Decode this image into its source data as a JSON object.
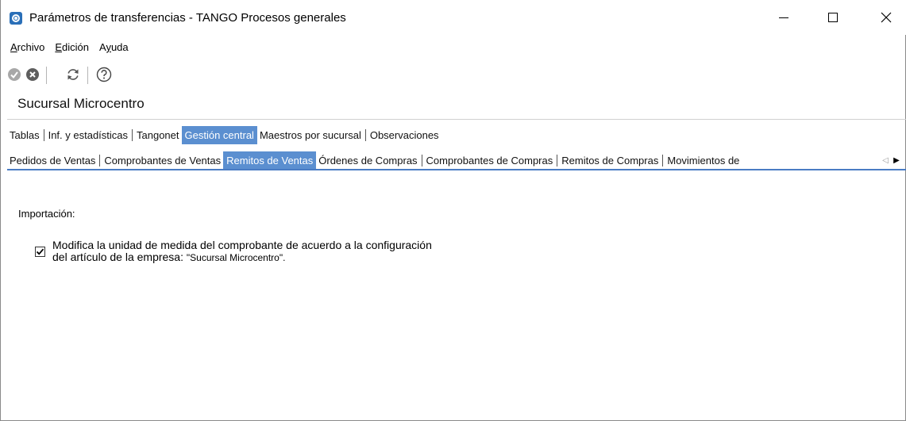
{
  "window": {
    "title": "Parámetros de transferencias - TANGO Procesos generales",
    "icon": "tango-app-icon"
  },
  "menu": {
    "items": [
      {
        "label_u": "A",
        "label_rest": "rchivo"
      },
      {
        "label_u": "E",
        "label_rest": "dición"
      },
      {
        "label_pre": "A",
        "label_u": "y",
        "label_rest": "uda"
      }
    ]
  },
  "toolbar": {
    "icons": [
      "check-icon",
      "cancel-icon",
      "refresh-icon",
      "help-icon"
    ]
  },
  "branch": {
    "title": "Sucursal Microcentro"
  },
  "tabs_main": [
    {
      "label": "Tablas",
      "active": false
    },
    {
      "label": "Inf. y estadísticas",
      "active": false
    },
    {
      "label": "Tangonet",
      "active": false
    },
    {
      "label": "Gestión central",
      "active": true
    },
    {
      "label": "Maestros por sucursal",
      "active": false
    },
    {
      "label": "Observaciones",
      "active": false
    }
  ],
  "tabs_sub": [
    {
      "label": "Pedidos de Ventas",
      "active": false
    },
    {
      "label": "Comprobantes de Ventas",
      "active": false
    },
    {
      "label": "Remitos de Ventas",
      "active": true
    },
    {
      "label": "Órdenes de Compras",
      "active": false
    },
    {
      "label": "Comprobantes de Compras",
      "active": false
    },
    {
      "label": "Remitos de Compras",
      "active": false
    },
    {
      "label": "Movimientos de",
      "active": false
    }
  ],
  "content": {
    "section_label": "Importación:",
    "option": {
      "checked": true,
      "line1": "Modifica la unidad de medida del comprobante de acuerdo a la configuración",
      "line2": "del artículo de la empresa:",
      "company": "\"Sucursal Microcentro\"."
    }
  },
  "colors": {
    "active_tab": "#5b8fd0",
    "tab_rule": "#4a7cc4"
  }
}
